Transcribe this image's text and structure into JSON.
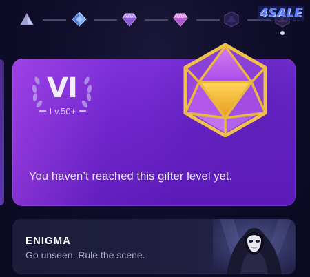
{
  "watermark": {
    "text": "4SALE"
  },
  "level_track": {
    "gems": [
      {
        "name": "level-1-gem-icon",
        "state": "unlocked"
      },
      {
        "name": "level-2-gem-icon",
        "state": "unlocked"
      },
      {
        "name": "level-3-gem-icon",
        "state": "unlocked"
      },
      {
        "name": "level-4-gem-icon",
        "state": "unlocked"
      },
      {
        "name": "level-5-gem-icon",
        "state": "locked"
      },
      {
        "name": "level-6-gem-icon",
        "state": "locked",
        "selected": true
      }
    ]
  },
  "level_card": {
    "numeral": "VI",
    "level_range": "Lv.50+",
    "status": "You haven’t reached this gifter level yet.",
    "gem_icon": "icosahedron-gem-icon",
    "colors": {
      "card": "#6a22c8",
      "gem_frame": "#e6b73a",
      "gem_face": "#b455e8"
    }
  },
  "enigma_card": {
    "title": "ENIGMA",
    "subtitle": "Go unseen. Rule the scene.",
    "art_icon": "hooded-masked-figure-icon"
  }
}
